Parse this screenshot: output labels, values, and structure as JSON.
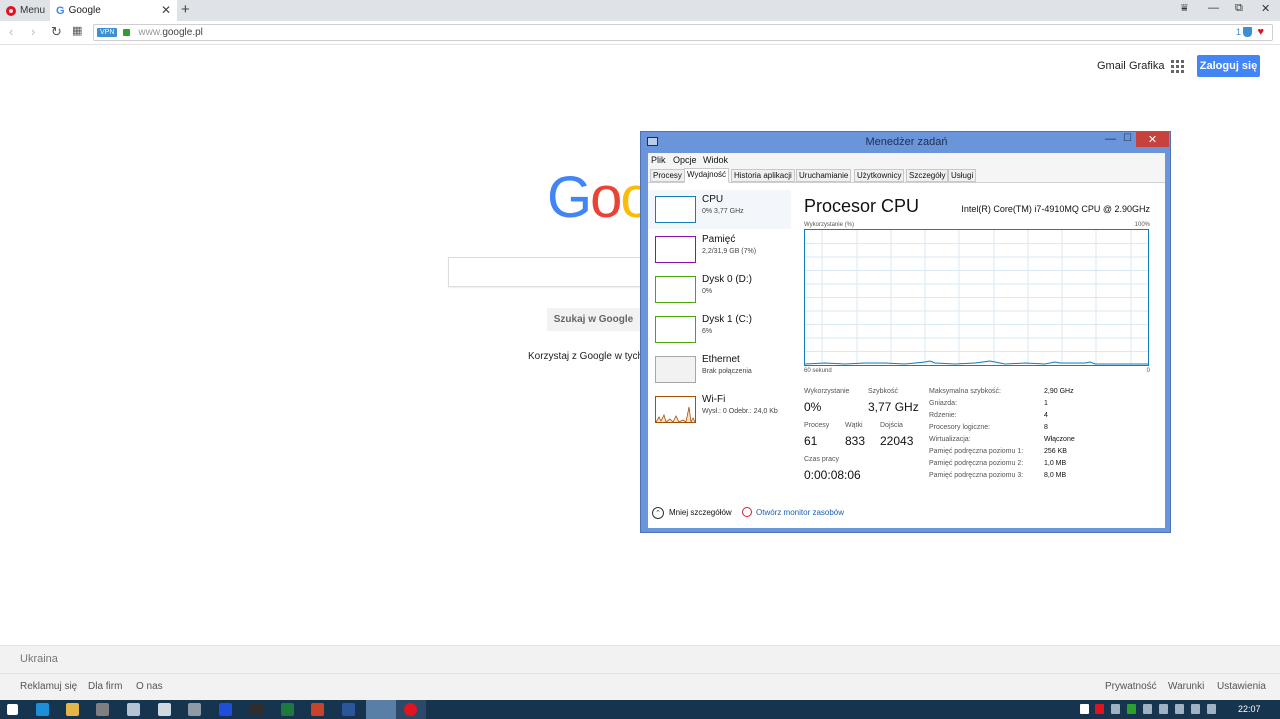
{
  "browser": {
    "menu_label": "Menu",
    "tab_title": "Google",
    "tab_close": "✕",
    "new_tab": "+",
    "vpn_badge": "VPN",
    "url_prefix": "www.",
    "url_domain": "google.pl",
    "badge_count": "1",
    "window_controls": {
      "menu": "⩸",
      "minimize": "—",
      "restore": "⧉",
      "close": "✕"
    }
  },
  "google": {
    "header_links": [
      "Gmail",
      "Grafika"
    ],
    "signin_label": "Zaloguj się",
    "logo_letters": [
      {
        "char": "G",
        "color": "#4285f4"
      },
      {
        "char": "o",
        "color": "#ea4335"
      },
      {
        "char": "o",
        "color": "#fbbc05"
      }
    ],
    "search_button": "Szukaj w Google",
    "offered_text": "Korzystaj z Google w tych języ",
    "footer": {
      "country": "Ukraina",
      "left_links": [
        "Reklamuj się",
        "Dla firm",
        "O nas"
      ],
      "right_links": [
        "Prywatność",
        "Warunki",
        "Ustawienia"
      ]
    }
  },
  "task_manager": {
    "title": "Menedżer zadań",
    "menu": [
      "Plik",
      "Opcje",
      "Widok"
    ],
    "tabs": [
      {
        "label": "Procesy",
        "active": false
      },
      {
        "label": "Wydajność",
        "active": true
      },
      {
        "label": "Historia aplikacji",
        "active": false
      },
      {
        "label": "Uruchamianie",
        "active": false
      },
      {
        "label": "Użytkownicy",
        "active": false
      },
      {
        "label": "Szczegóły",
        "active": false
      },
      {
        "label": "Usługi",
        "active": false
      }
    ],
    "resources": [
      {
        "name": "CPU",
        "sub": "0% 3,77 GHz",
        "color": "#117dbb"
      },
      {
        "name": "Pamięć",
        "sub": "2,2/31,9 GB (7%)",
        "color": "#8b12ae"
      },
      {
        "name": "Dysk 0 (D:)",
        "sub": "0%",
        "color": "#4da60c"
      },
      {
        "name": "Dysk 1 (C:)",
        "sub": "6%",
        "color": "#4da60c"
      },
      {
        "name": "Ethernet",
        "sub": "Brak połączenia",
        "color": "#a7a7a7"
      },
      {
        "name": "Wi-Fi",
        "sub": "Wysł.: 0 Odebr.: 24,0 Kb",
        "color": "#a74f01"
      }
    ],
    "detail": {
      "title": "Procesor CPU",
      "model": "Intel(R) Core(TM) i7-4910MQ CPU @ 2.90GHz",
      "graph_label_left": "Wykorzystanie (%)",
      "graph_label_right": "100%",
      "graph_bottom_left": "60 sekund",
      "graph_bottom_right": "0",
      "utilization_label": "Wykorzystanie",
      "utilization": "0%",
      "speed_label": "Szybkość",
      "speed": "3,77 GHz",
      "processes_label": "Procesy",
      "processes": "61",
      "threads_label": "Wątki",
      "threads": "833",
      "handles_label": "Dojścia",
      "handles": "22043",
      "uptime_label": "Czas pracy",
      "uptime": "0:00:08:06",
      "specs": [
        {
          "k": "Maksymalna szybkość:",
          "v": "2,90 GHz"
        },
        {
          "k": "Gniazda:",
          "v": "1"
        },
        {
          "k": "Rdzenie:",
          "v": "4"
        },
        {
          "k": "Procesory logiczne:",
          "v": "8"
        },
        {
          "k": "Wirtualizacja:",
          "v": "Włączone"
        },
        {
          "k": "Pamięć podręczna poziomu 1:",
          "v": "256 KB"
        },
        {
          "k": "Pamięć podręczna poziomu 2:",
          "v": "1,0 MB"
        },
        {
          "k": "Pamięć podręczna poziomu 3:",
          "v": "8,0 MB"
        }
      ]
    },
    "fewer_details": "Mniej szczegółów",
    "open_monitor": "Otwórz monitor zasobów"
  },
  "taskbar": {
    "clock": "22:07"
  }
}
